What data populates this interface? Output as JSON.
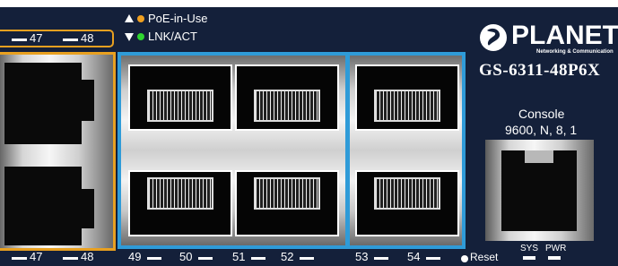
{
  "legend": {
    "poe_label": "PoE-in-Use",
    "lnk_label": "LNK/ACT",
    "poe_color": "#f0a020",
    "lnk_color": "#2fd62f"
  },
  "brand": {
    "logo_text": "PLANET",
    "tagline": "Networking & Communication",
    "model": "GS-6311-48P6X"
  },
  "console": {
    "label": "Console",
    "settings": "9600, N, 8, 1"
  },
  "ports": {
    "top_left": [
      "47",
      "48"
    ],
    "bottom_left": [
      "47",
      "48"
    ],
    "sfp_labels": [
      "49",
      "50",
      "51",
      "52",
      "53",
      "54"
    ]
  },
  "status_leds": [
    "SYS",
    "PWR"
  ],
  "reset_label": "Reset",
  "colors": {
    "panel": "#14203a",
    "orange_outline": "#e8a020",
    "sfp_blue": "#2f9bd8"
  }
}
